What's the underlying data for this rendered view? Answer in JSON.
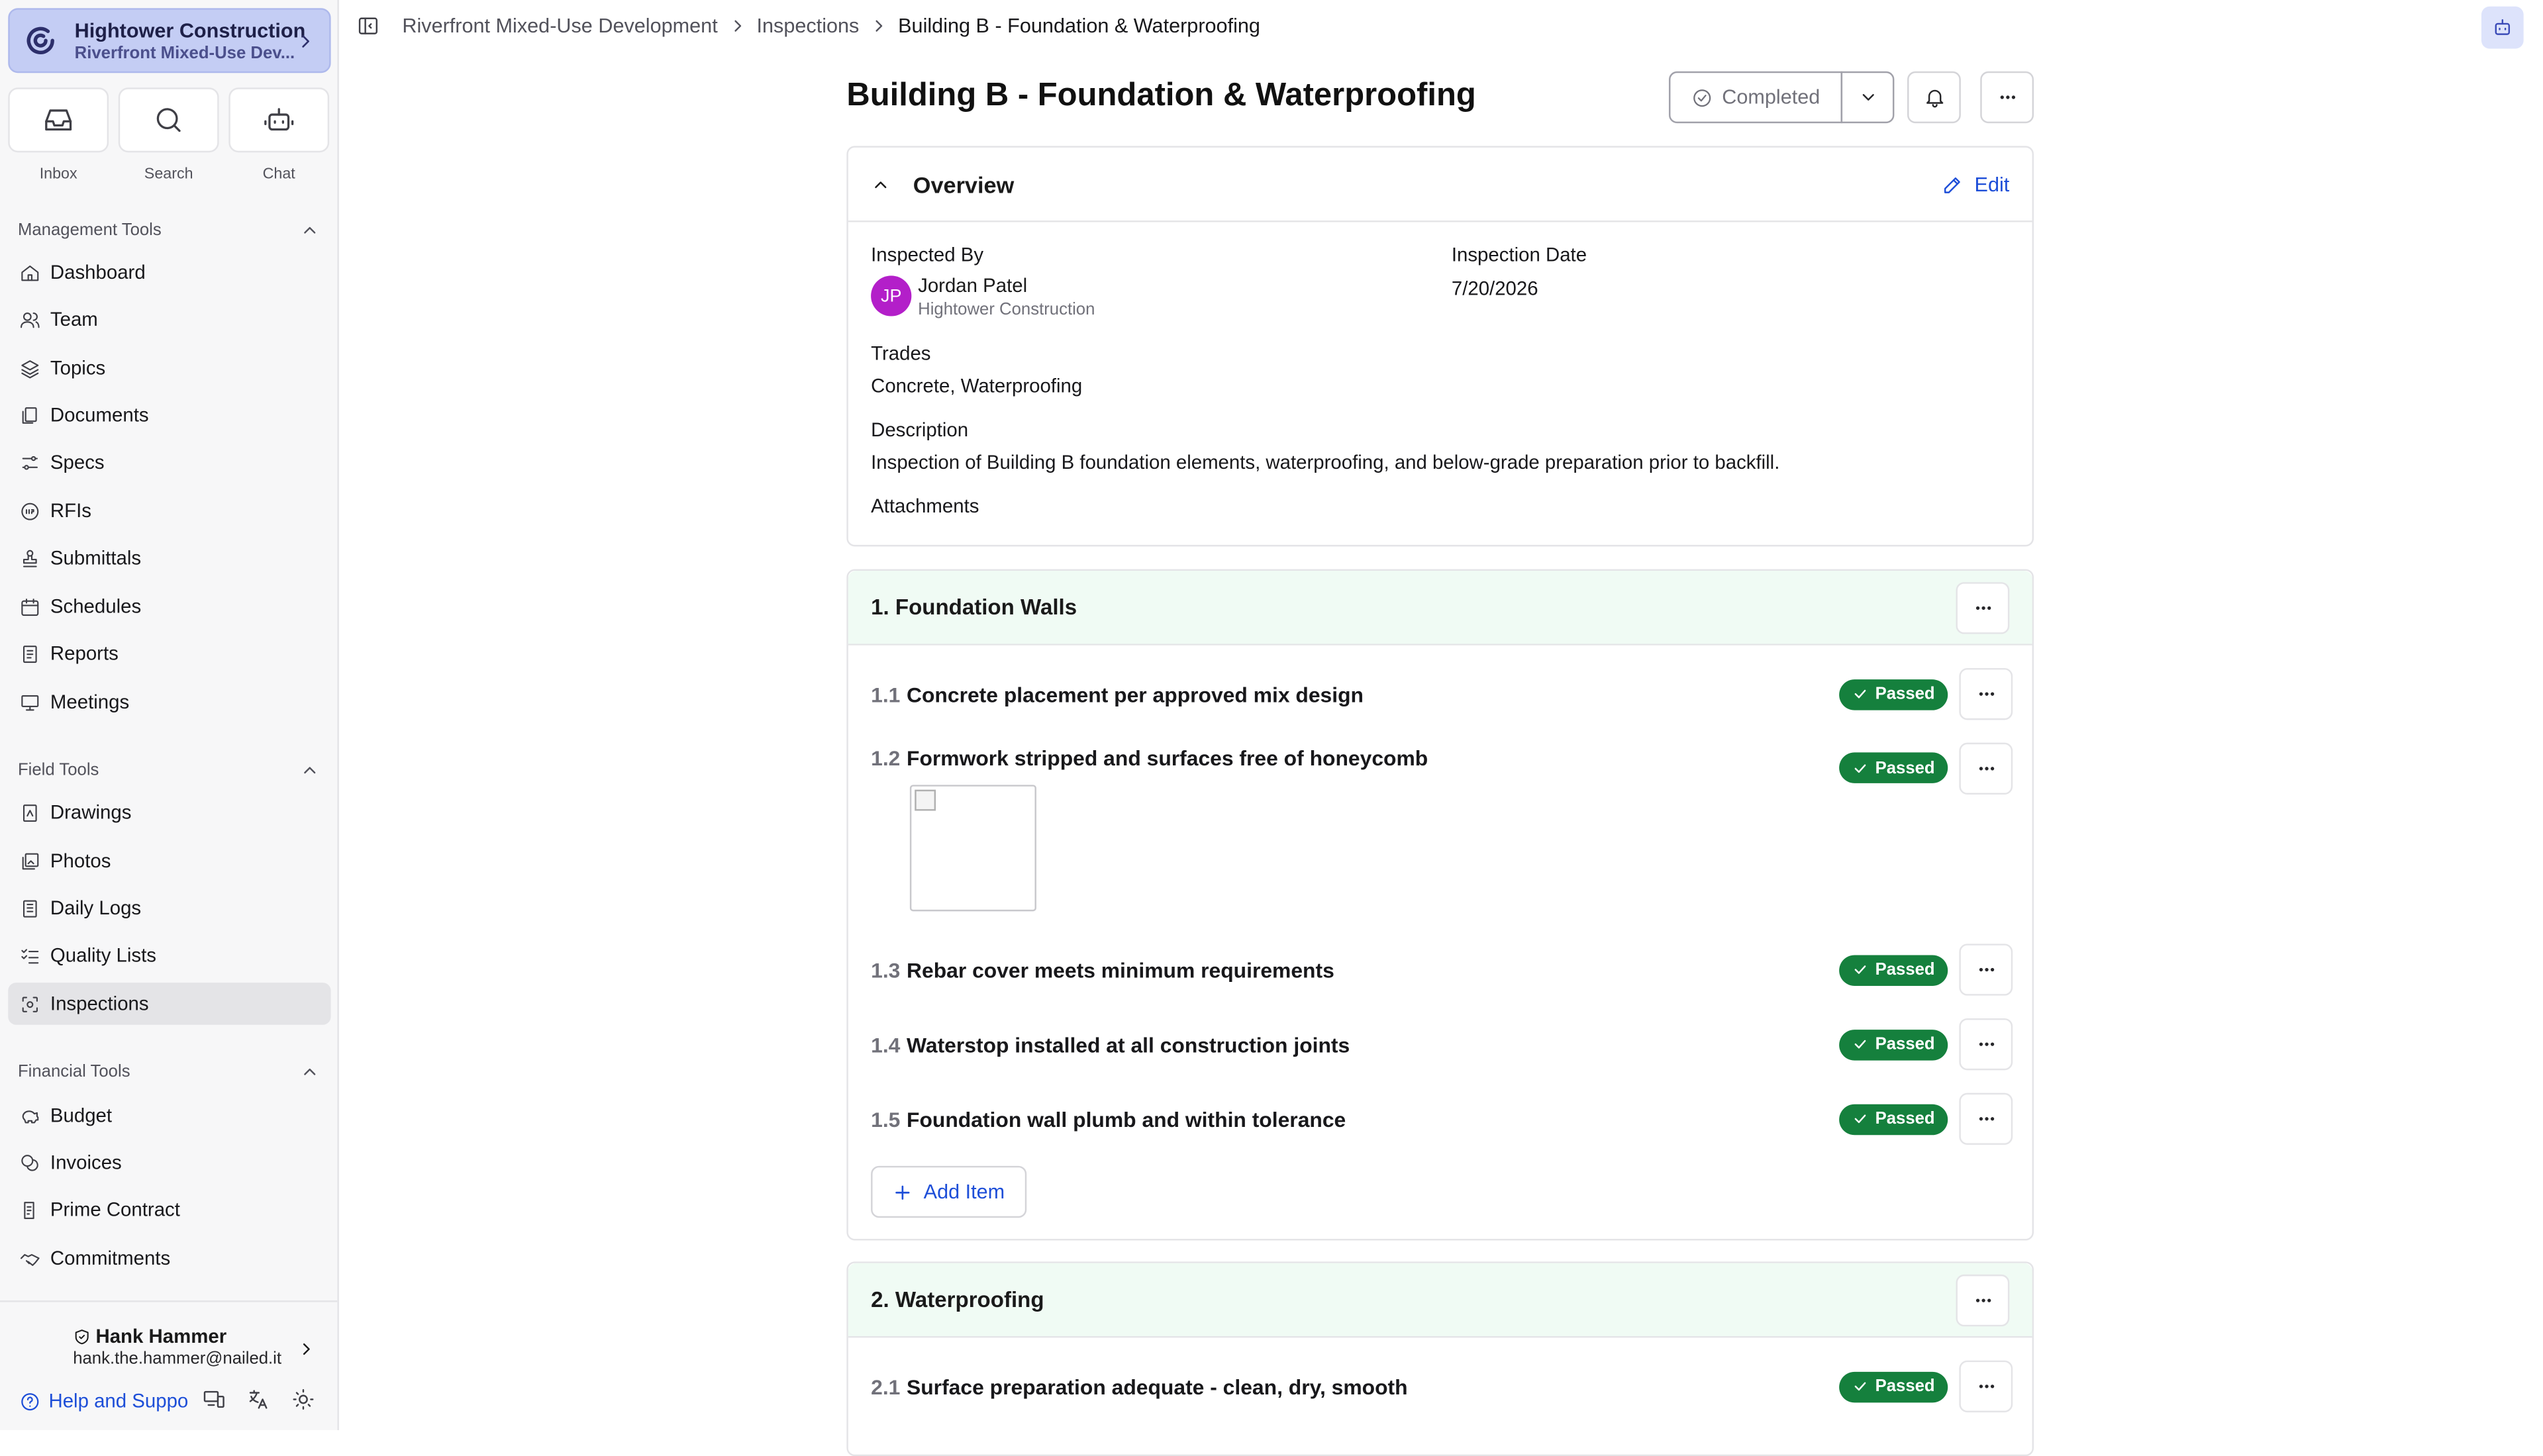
{
  "org": {
    "name": "Hightower Construction",
    "project": "Riverfront Mixed-Use Dev..."
  },
  "quick": {
    "inbox": "Inbox",
    "search": "Search",
    "chat": "Chat"
  },
  "sections": {
    "management": "Management Tools",
    "field": "Field Tools",
    "financial": "Financial Tools"
  },
  "nav": {
    "management": [
      "Dashboard",
      "Team",
      "Topics",
      "Documents",
      "Specs",
      "RFIs",
      "Submittals",
      "Schedules",
      "Reports",
      "Meetings"
    ],
    "field": [
      "Drawings",
      "Photos",
      "Daily Logs",
      "Quality Lists",
      "Inspections"
    ],
    "financial": [
      "Budget",
      "Invoices",
      "Prime Contract",
      "Commitments"
    ]
  },
  "user": {
    "name": "Hank Hammer",
    "email": "hank.the.hammer@nailed.it"
  },
  "help_label": "Help and Suppo",
  "breadcrumb": [
    "Riverfront Mixed-Use Development",
    "Inspections",
    "Building B - Foundation & Waterproofing"
  ],
  "page": {
    "title": "Building B - Foundation & Waterproofing",
    "status": "Completed"
  },
  "overview": {
    "heading": "Overview",
    "edit_label": "Edit",
    "inspected_by_label": "Inspected By",
    "inspector_initials": "JP",
    "inspector_name": "Jordan Patel",
    "inspector_company": "Hightower Construction",
    "date_label": "Inspection Date",
    "date_value": "7/20/2026",
    "trades_label": "Trades",
    "trades_value": "Concrete, Waterproofing",
    "description_label": "Description",
    "description_value": "Inspection of Building B foundation elements, waterproofing, and below-grade preparation prior to backfill.",
    "attachments_label": "Attachments"
  },
  "sections_list": [
    {
      "title": "1. Foundation Walls",
      "items": [
        {
          "num": "1.1",
          "text": "Concrete placement per approved mix design",
          "status": "Passed"
        },
        {
          "num": "1.2",
          "text": "Formwork stripped and surfaces free of honeycomb",
          "status": "Passed"
        },
        {
          "num": "1.3",
          "text": "Rebar cover meets minimum requirements",
          "status": "Passed"
        },
        {
          "num": "1.4",
          "text": "Waterstop installed at all construction joints",
          "status": "Passed"
        },
        {
          "num": "1.5",
          "text": "Foundation wall plumb and within tolerance",
          "status": "Passed"
        }
      ],
      "add_label": "Add Item"
    },
    {
      "title": "2. Waterproofing",
      "items": [
        {
          "num": "2.1",
          "text": "Surface preparation adequate - clean, dry, smooth",
          "status": "Passed"
        }
      ]
    }
  ],
  "colors": {
    "accent": "#1d4ed8",
    "passed": "#15803d",
    "org_bg": "#c4cdf4",
    "section_bg": "#f0fbf4",
    "avatar": "#b31fc9"
  }
}
